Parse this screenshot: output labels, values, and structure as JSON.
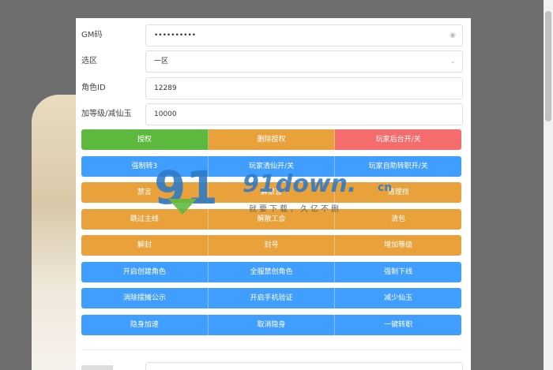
{
  "form": {
    "gm_code": {
      "label": "GM码",
      "value": "••••••••••"
    },
    "region": {
      "label": "选区",
      "value": "一区"
    },
    "role_id": {
      "label": "角色ID",
      "value": "12289"
    },
    "amount": {
      "label": "加等级/减仙玉",
      "value": "10000"
    }
  },
  "button_rows": [
    [
      {
        "name": "authorize-button",
        "label": "授权",
        "color": "#5cb93d"
      },
      {
        "name": "revoke-authorize-button",
        "label": "删除授权",
        "color": "#e9a23b"
      },
      {
        "name": "player-backend-toggle-button",
        "label": "玩家后台开/关",
        "color": "#f56c6c"
      }
    ],
    [
      {
        "name": "force-change-button",
        "label": "强制转3",
        "color": "#409eff"
      },
      {
        "name": "player-xian-toggle-button",
        "label": "玩家清仙开/关",
        "color": "#409eff"
      },
      {
        "name": "player-self-job-toggle-button",
        "label": "玩家自助转职开/关",
        "color": "#409eff"
      }
    ],
    [
      {
        "name": "ban-speak-button",
        "label": "禁言",
        "color": "#e9a23b"
      },
      {
        "name": "unban-speak-button",
        "label": "解禁言",
        "color": "#e9a23b"
      },
      {
        "name": "clear-shield-button",
        "label": "清理挡",
        "color": "#e9a23b"
      }
    ],
    [
      {
        "name": "skip-mainline-button",
        "label": "跳过主线",
        "color": "#e9a23b"
      },
      {
        "name": "disband-guild-button",
        "label": "解散工会",
        "color": "#e9a23b"
      },
      {
        "name": "clear-bag-button",
        "label": "清包",
        "color": "#e9a23b"
      }
    ],
    [
      {
        "name": "unseal-button",
        "label": "解封",
        "color": "#e9a23b"
      },
      {
        "name": "seal-account-button",
        "label": "封号",
        "color": "#e9a23b"
      },
      {
        "name": "add-level-button",
        "label": "增加等级",
        "color": "#e9a23b"
      }
    ],
    [
      {
        "name": "enable-create-role-button",
        "label": "开启创建角色",
        "color": "#409eff"
      },
      {
        "name": "server-ban-role-button",
        "label": "全服禁创角色",
        "color": "#409eff"
      },
      {
        "name": "force-offline-button",
        "label": "强制下线",
        "color": "#409eff"
      }
    ],
    [
      {
        "name": "clear-stall-notice-button",
        "label": "消除摆摊公示",
        "color": "#409eff"
      },
      {
        "name": "enable-phone-verify-button",
        "label": "开启手机验证",
        "color": "#409eff"
      },
      {
        "name": "reduce-jade-button",
        "label": "减少仙玉",
        "color": "#409eff"
      }
    ],
    [
      {
        "name": "stealth-speed-button",
        "label": "隐身加速",
        "color": "#409eff"
      },
      {
        "name": "cancel-stealth-button",
        "label": "取消隐身",
        "color": "#409eff"
      },
      {
        "name": "one-key-job-change-button",
        "label": "一键转职",
        "color": "#409eff"
      }
    ]
  ],
  "watermark": {
    "number": "91",
    "site": "91down.",
    "tld": "cn",
    "tagline": "就要下载，久亿不删"
  }
}
